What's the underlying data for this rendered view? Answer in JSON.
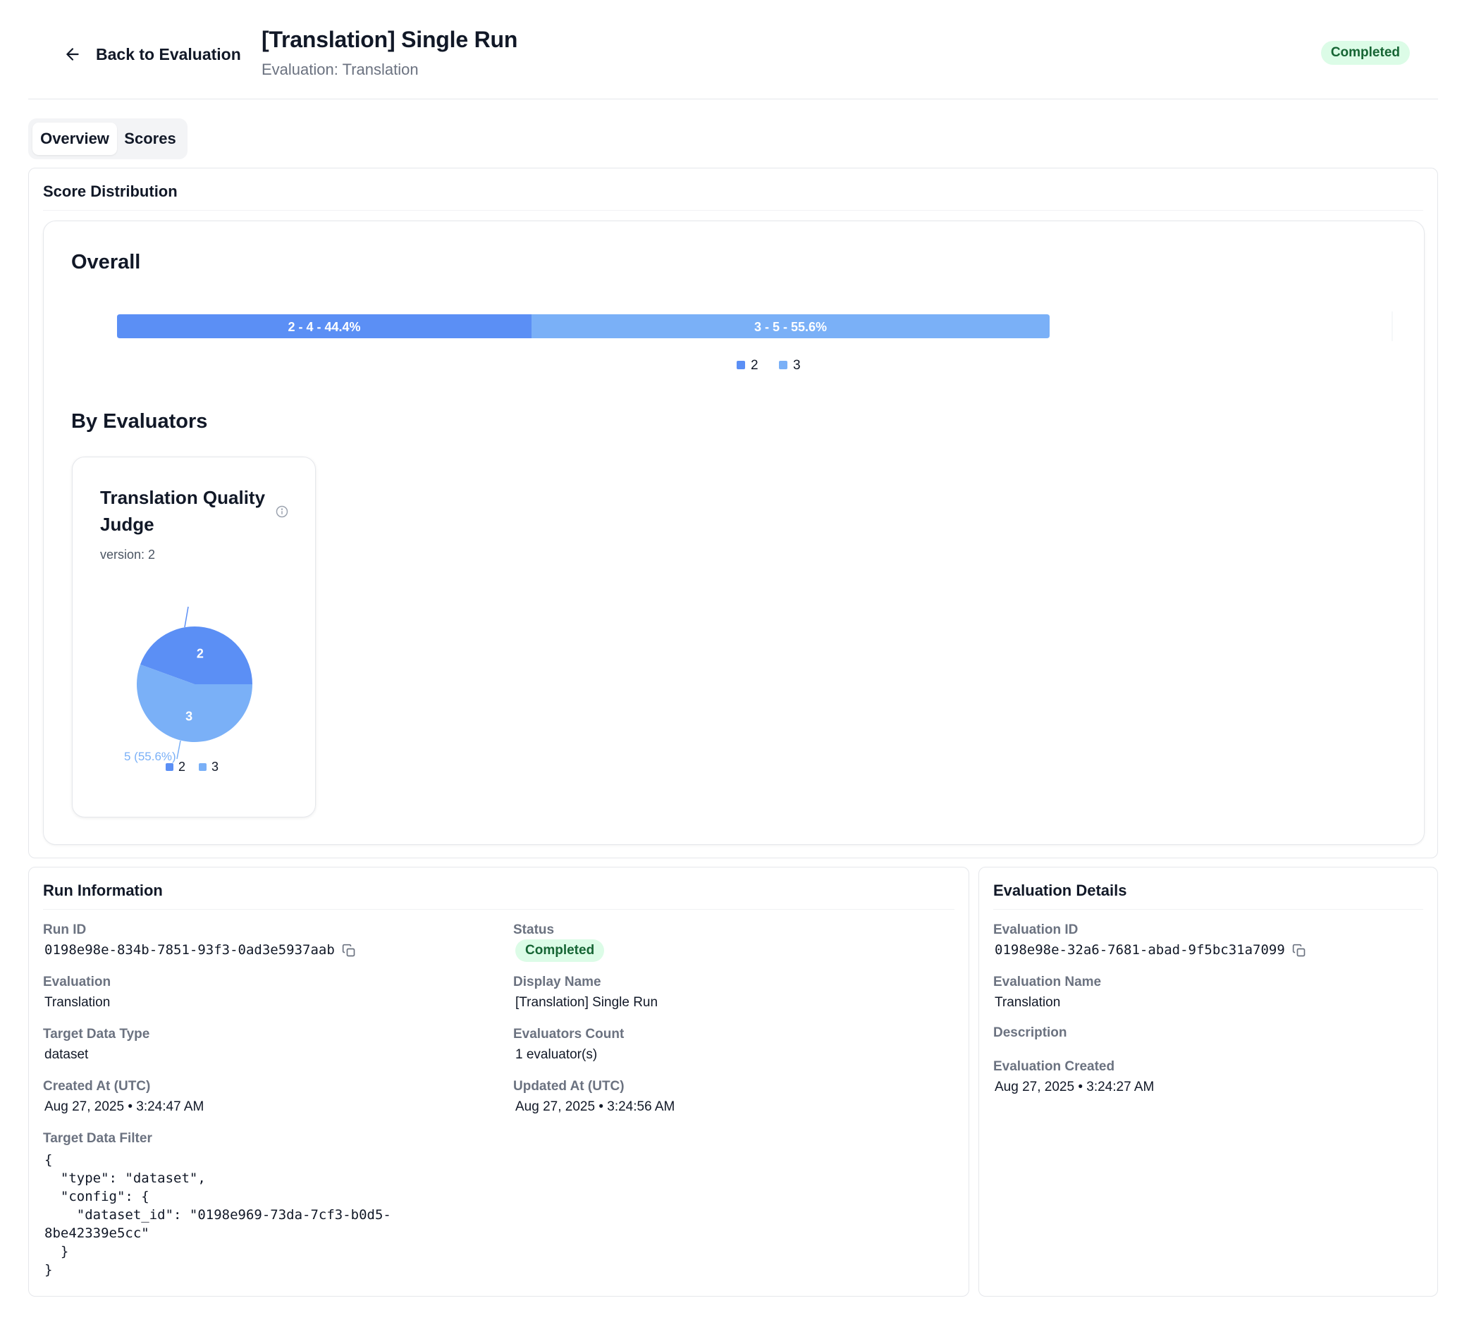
{
  "header": {
    "back_label": "Back to Evaluation",
    "title": "[Translation] Single Run",
    "subtitle": "Evaluation: Translation",
    "status": "Completed"
  },
  "tabs": [
    {
      "label": "Overview",
      "active": true
    },
    {
      "label": "Scores",
      "active": false
    }
  ],
  "score_distribution": {
    "title": "Score Distribution",
    "overall_heading": "Overall",
    "by_evaluators_heading": "By Evaluators",
    "evaluator": {
      "name": "Translation Quality Judge",
      "version": "version: 2",
      "outer_label": "5 (55.6%)"
    }
  },
  "chart_data": [
    {
      "type": "bar",
      "orientation": "horizontal-stacked",
      "title": "Overall",
      "segments": [
        {
          "name": "2",
          "count": 4,
          "percent": 44.4,
          "label": "2 - 4 - 44.4%",
          "color": "#5b8ff5"
        },
        {
          "name": "3",
          "count": 5,
          "percent": 55.6,
          "label": "3 - 5 - 55.6%",
          "color": "#7ab0f7"
        }
      ],
      "legend": [
        "2",
        "3"
      ],
      "legend_position": "bottom"
    },
    {
      "type": "pie",
      "title": "Translation Quality Judge",
      "slices": [
        {
          "name": "2",
          "value": 4,
          "percent": 44.4,
          "color": "#5b8ff5"
        },
        {
          "name": "3",
          "value": 5,
          "percent": 55.6,
          "color": "#7ab0f7"
        }
      ],
      "legend": [
        "2",
        "3"
      ],
      "legend_position": "bottom"
    }
  ],
  "run_info": {
    "title": "Run Information",
    "run_id_label": "Run ID",
    "run_id": "0198e98e-834b-7851-93f3-0ad3e5937aab",
    "status_label": "Status",
    "status": "Completed",
    "evaluation_label": "Evaluation",
    "evaluation": "Translation",
    "display_name_label": "Display Name",
    "display_name": "[Translation] Single Run",
    "target_type_label": "Target Data Type",
    "target_type": "dataset",
    "evaluators_count_label": "Evaluators Count",
    "evaluators_count": "1 evaluator(s)",
    "created_label": "Created At (UTC)",
    "created": "Aug 27, 2025 • 3:24:47 AM",
    "updated_label": "Updated At (UTC)",
    "updated": "Aug 27, 2025 • 3:24:56 AM",
    "filter_label": "Target Data Filter",
    "filter_json": "{\n  \"type\": \"dataset\",\n  \"config\": {\n    \"dataset_id\": \"0198e969-73da-7cf3-b0d5-\n8be42339e5cc\"\n  }\n}"
  },
  "eval_details": {
    "title": "Evaluation Details",
    "id_label": "Evaluation ID",
    "id": "0198e98e-32a6-7681-abad-9f5bc31a7099",
    "name_label": "Evaluation Name",
    "name": "Translation",
    "description_label": "Description",
    "created_label": "Evaluation Created",
    "created": "Aug 27, 2025 • 3:24:27 AM"
  },
  "icons": {
    "back": "arrow-left-icon",
    "copy": "copy-icon",
    "info": "info-icon"
  }
}
